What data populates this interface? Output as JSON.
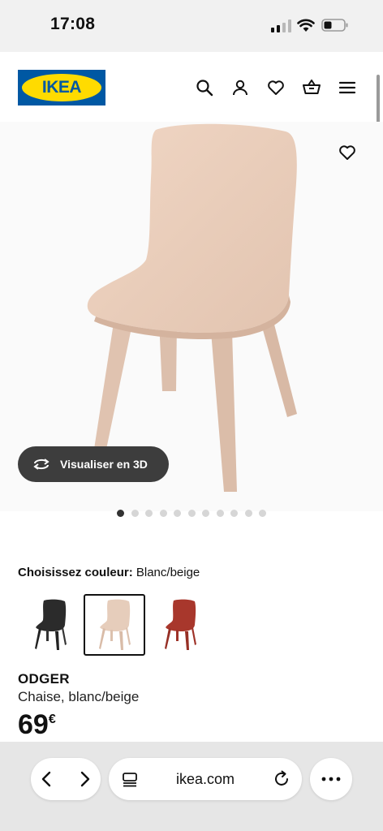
{
  "status_bar": {
    "time": "17:08"
  },
  "header": {
    "logo_text": "IKEA",
    "icons": [
      "search-icon",
      "account-icon",
      "heart-icon",
      "basket-icon",
      "menu-icon"
    ]
  },
  "gallery": {
    "button_3d_label": "Visualiser en 3D",
    "dot_count": 11,
    "active_dot": 1
  },
  "color_chooser": {
    "label": "Choisissez couleur:",
    "selected_value": "Blanc/beige",
    "swatches": [
      {
        "name": "anthracite",
        "color": "#2b2b2b"
      },
      {
        "name": "blanc-beige",
        "color": "#e6cdbb",
        "selected": true
      },
      {
        "name": "rouge",
        "color": "#a8372c"
      }
    ]
  },
  "product": {
    "name": "ODGER",
    "description": "Chaise, blanc/beige",
    "price": "69",
    "currency": "€"
  },
  "browser": {
    "url": "ikea.com"
  },
  "colors": {
    "ikea_blue": "#0058a3",
    "ikea_yellow": "#ffdb00",
    "chair_beige": "#e8cdbb"
  }
}
